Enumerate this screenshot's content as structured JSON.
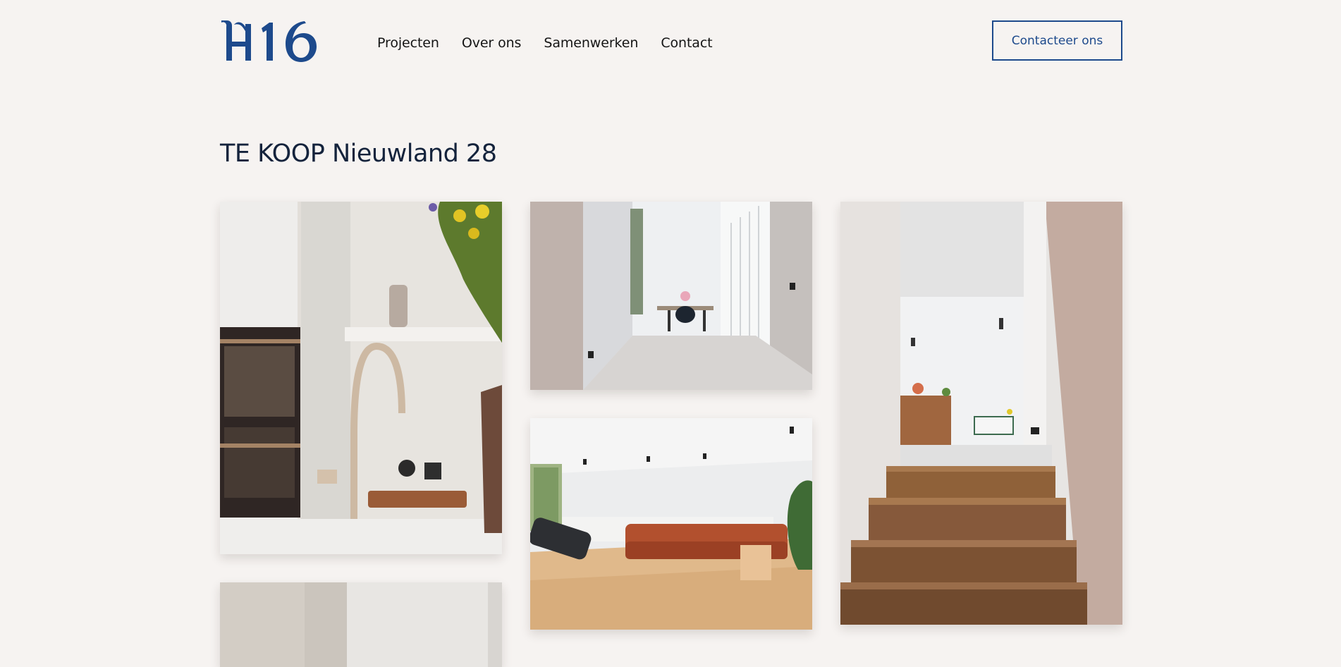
{
  "header": {
    "logo_text": "H16",
    "nav": [
      {
        "label": "Projecten"
      },
      {
        "label": "Over ons"
      },
      {
        "label": "Samenwerken"
      },
      {
        "label": "Contact"
      }
    ],
    "cta_label": "Contacteer ons"
  },
  "main": {
    "title": "TE KOOP Nieuwland 28"
  },
  "colors": {
    "background": "#f6f3f1",
    "brand_blue": "#1d4a8c",
    "title_navy": "#14233c"
  },
  "icons": {
    "logo": "h16-logo"
  }
}
